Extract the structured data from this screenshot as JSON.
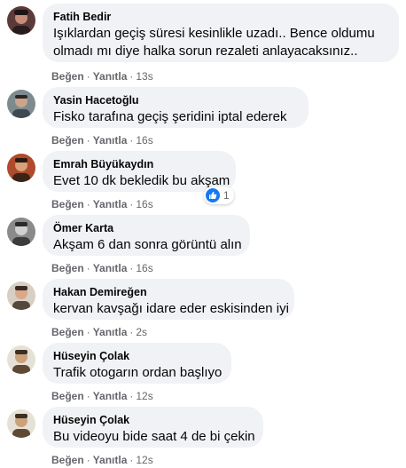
{
  "comments": [
    {
      "author": "Fatih Bedir",
      "lines": [
        "Işıklardan geçiş süresi kesinlikle uzadı.. Bence oldumu",
        "olmadı mı diye halka sorun rezaleti anlayacaksınız.."
      ],
      "like_label": "Beğen",
      "reply_label": "Yanıtla",
      "time": "13s"
    },
    {
      "author": "Yasin Hacetoğlu",
      "lines": [
        "Fisko tarafına geçiş şeridini iptal ederek"
      ],
      "like_label": "Beğen",
      "reply_label": "Yanıtla",
      "time": "16s"
    },
    {
      "author": "Emrah Büyükaydın",
      "lines": [
        "Evet 10 dk bekledik bu akşam"
      ],
      "like_label": "Beğen",
      "reply_label": "Yanıtla",
      "time": "16s",
      "reaction_count": "1"
    },
    {
      "author": "Ömer Karta",
      "lines": [
        "Akşam 6 dan sonra görüntü alın"
      ],
      "like_label": "Beğen",
      "reply_label": "Yanıtla",
      "time": "16s"
    },
    {
      "author": "Hakan Demireğen",
      "lines": [
        "kervan kavşağı idare eder eskisinden iyi"
      ],
      "like_label": "Beğen",
      "reply_label": "Yanıtla",
      "time": "2s"
    },
    {
      "author": "Hüseyin Çolak",
      "lines": [
        "Trafik otogarın ordan başlıyo"
      ],
      "like_label": "Beğen",
      "reply_label": "Yanıtla",
      "time": "12s"
    },
    {
      "author": "Hüseyin Çolak",
      "lines": [
        "Bu videoyu bide saat 4 de bi çekin"
      ],
      "like_label": "Beğen",
      "reply_label": "Yanıtla",
      "time": "12s"
    }
  ],
  "separator": "·",
  "colors": {
    "bubble": "#f0f2f5",
    "action_text": "#65676b",
    "like_blue": "#1877f2"
  },
  "icons": {
    "reaction": "like-thumb-icon"
  }
}
